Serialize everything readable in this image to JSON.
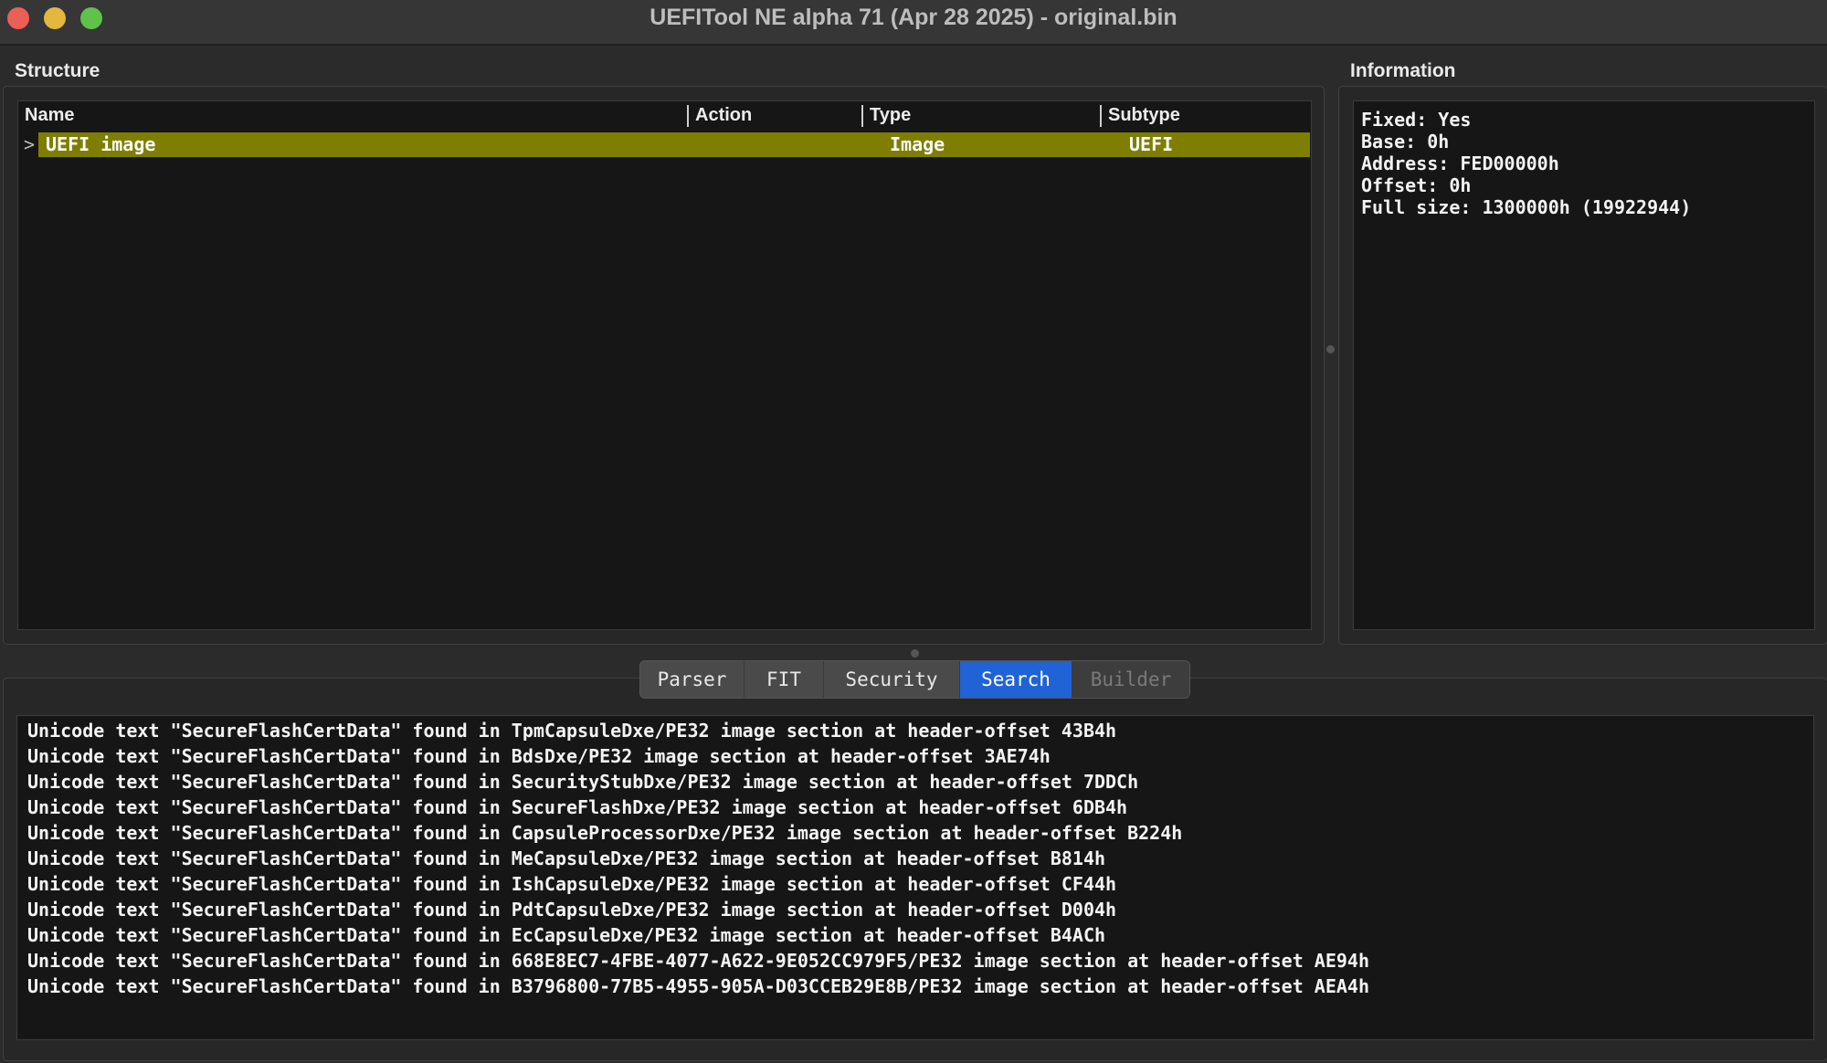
{
  "window": {
    "title": "UEFITool NE alpha 71 (Apr 28 2025) - original.bin"
  },
  "structure": {
    "label": "Structure",
    "columns": [
      "Name",
      "Action",
      "Type",
      "Subtype"
    ],
    "rows": [
      {
        "name": "UEFI image",
        "action": "",
        "type": "Image",
        "subtype": "UEFI",
        "selected": true,
        "expander": ">"
      }
    ]
  },
  "information": {
    "label": "Information",
    "lines": [
      "Fixed: Yes",
      "Base: 0h",
      "Address: FED00000h",
      "Offset: 0h",
      "Full size: 1300000h (19922944)"
    ]
  },
  "tabs": [
    {
      "label": "Parser",
      "active": false,
      "enabled": true
    },
    {
      "label": "FIT",
      "active": false,
      "enabled": true
    },
    {
      "label": "Security",
      "active": false,
      "enabled": true
    },
    {
      "label": "Search",
      "active": true,
      "enabled": true
    },
    {
      "label": "Builder",
      "active": false,
      "enabled": false
    }
  ],
  "messages": [
    "Unicode text \"SecureFlashCertData\" found in TpmCapsuleDxe/PE32 image section at header-offset 43B4h",
    "Unicode text \"SecureFlashCertData\" found in BdsDxe/PE32 image section at header-offset 3AE74h",
    "Unicode text \"SecureFlashCertData\" found in SecurityStubDxe/PE32 image section at header-offset 7DDCh",
    "Unicode text \"SecureFlashCertData\" found in SecureFlashDxe/PE32 image section at header-offset 6DB4h",
    "Unicode text \"SecureFlashCertData\" found in CapsuleProcessorDxe/PE32 image section at header-offset B224h",
    "Unicode text \"SecureFlashCertData\" found in MeCapsuleDxe/PE32 image section at header-offset B814h",
    "Unicode text \"SecureFlashCertData\" found in IshCapsuleDxe/PE32 image section at header-offset CF44h",
    "Unicode text \"SecureFlashCertData\" found in PdtCapsuleDxe/PE32 image section at header-offset D004h",
    "Unicode text \"SecureFlashCertData\" found in EcCapsuleDxe/PE32 image section at header-offset B4ACh",
    "Unicode text \"SecureFlashCertData\" found in 668E8EC7-4FBE-4077-A622-9E052CC979F5/PE32 image section at header-offset AE94h",
    "Unicode text \"SecureFlashCertData\" found in B3796800-77B5-4955-905A-D03CCEB29E8B/PE32 image section at header-offset AEA4h"
  ],
  "colors": {
    "selection": "#7e7e00",
    "active_tab": "#2063d6",
    "close": "#ec5f57",
    "minimize": "#e4b73d",
    "maximize": "#5fc24a"
  }
}
